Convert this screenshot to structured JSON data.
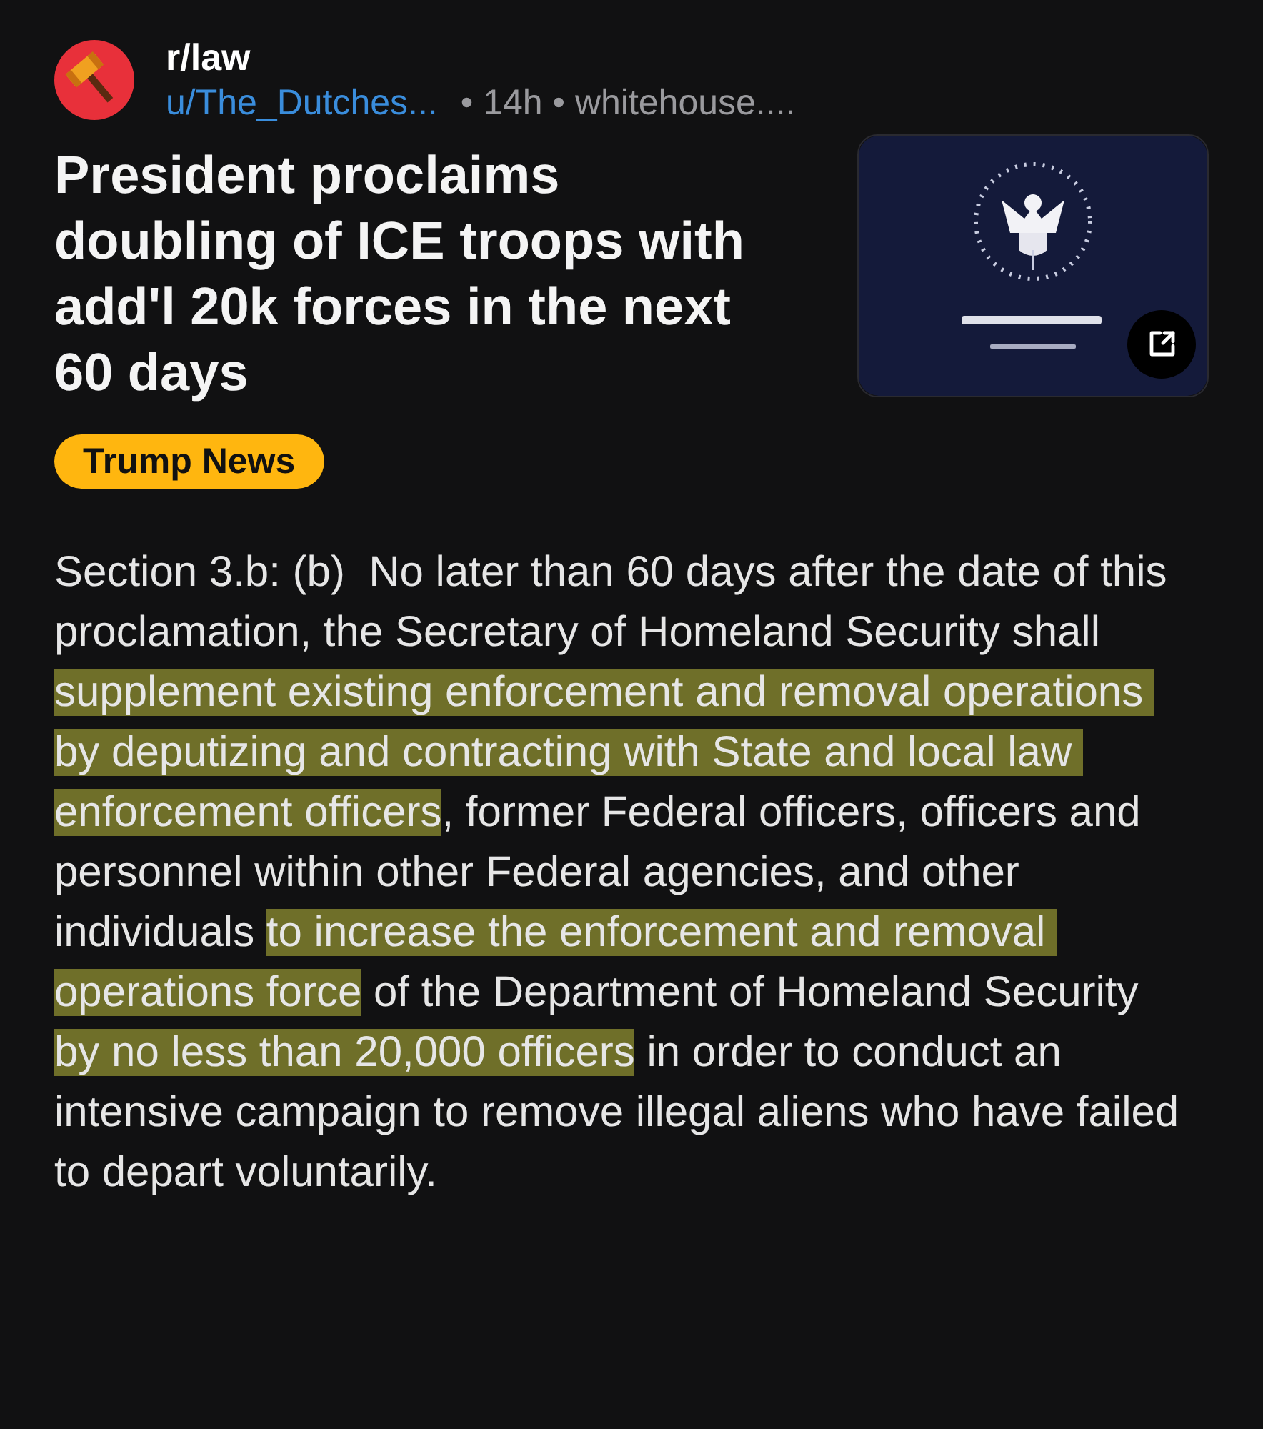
{
  "post": {
    "subreddit": "r/law",
    "author": "u/The_Dutches...",
    "meta": "• 14h • whitehouse....",
    "title": "President proclaims doubling of ICE troops with add'l 20k forces in the next 60 days",
    "flair": "Trump News",
    "body": [
      {
        "text": "Section 3.b: (b)  No later than 60 days after the date of this proclamation, the Secretary of Homeland Security shall ",
        "highlighted": false
      },
      {
        "text": "supplement existing enforcement and removal operations by deputizing and contracting with State and local law enforcement officers",
        "highlighted": true
      },
      {
        "text": ", former Federal officers, officers and personnel within other Federal agencies, and other individuals ",
        "highlighted": false
      },
      {
        "text": "to increase the enforcement and removal operations force",
        "highlighted": true
      },
      {
        "text": " of the Department of Homeland Security ",
        "highlighted": false
      },
      {
        "text": "by no less than 20,000 officers",
        "highlighted": true
      },
      {
        "text": " in order to conduct an intensive campaign to remove illegal aliens who have failed to depart voluntarily.",
        "highlighted": false
      }
    ]
  }
}
